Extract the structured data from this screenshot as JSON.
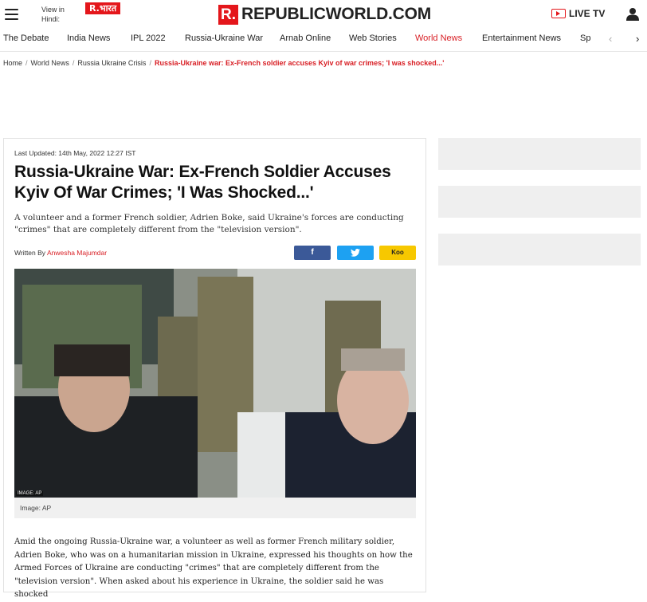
{
  "header": {
    "view_in_hindi": "View in Hindi:",
    "bharat_logo": "R.भारत",
    "brand_mark": "R.",
    "brand_name": "REPUBLICWORLD.COM",
    "live_tv": "LIVE TV",
    "icons": {
      "menu": "hamburger-icon",
      "live": "tv-play-icon",
      "user": "user-icon"
    }
  },
  "nav": {
    "items": [
      "The Debate",
      "India News",
      "IPL 2022",
      "Russia-Ukraine War",
      "Arnab Online",
      "Web Stories",
      "World News",
      "Entertainment News",
      "Sp"
    ],
    "active": "World News",
    "prev": "‹",
    "next": "›"
  },
  "breadcrumb": {
    "items": [
      "Home",
      "World News",
      "Russia Ukraine Crisis"
    ],
    "separator": "/",
    "current": "Russia-Ukraine war: Ex-French soldier accuses Kyiv of war crimes; 'I was shocked...'"
  },
  "article": {
    "last_updated": "Last Updated: 14th May, 2022 12:27 IST",
    "headline": "Russia-Ukraine War: Ex-French Soldier Accuses Kyiv Of War Crimes; 'I Was Shocked...'",
    "summary": "A volunteer and a former French soldier, Adrien Boke, said Ukraine's forces are conducting \"crimes\" that are completely different from the \"television version\".",
    "byline_prefix": "Written By",
    "author": "Anwesha Majumdar",
    "share": {
      "facebook": "f",
      "twitter": "twitter-bird-icon",
      "koo": "Koo"
    },
    "image_tag": "IMAGE: AP",
    "image_caption": "Image: AP",
    "body": "Amid the ongoing Russia-Ukraine war, a volunteer as well as former French military soldier, Adrien Boke, who was on a humanitarian mission in Ukraine, expressed his thoughts on how the Armed Forces of Ukraine are conducting \"crimes\" that are completely different from the \"television version\". When asked about his experience in Ukraine, the soldier said he was shocked"
  },
  "colors": {
    "brand_red": "#e4161b",
    "active_nav": "#d81e24",
    "facebook": "#3b5998",
    "twitter": "#1da1f2",
    "koo": "#f7c800"
  }
}
